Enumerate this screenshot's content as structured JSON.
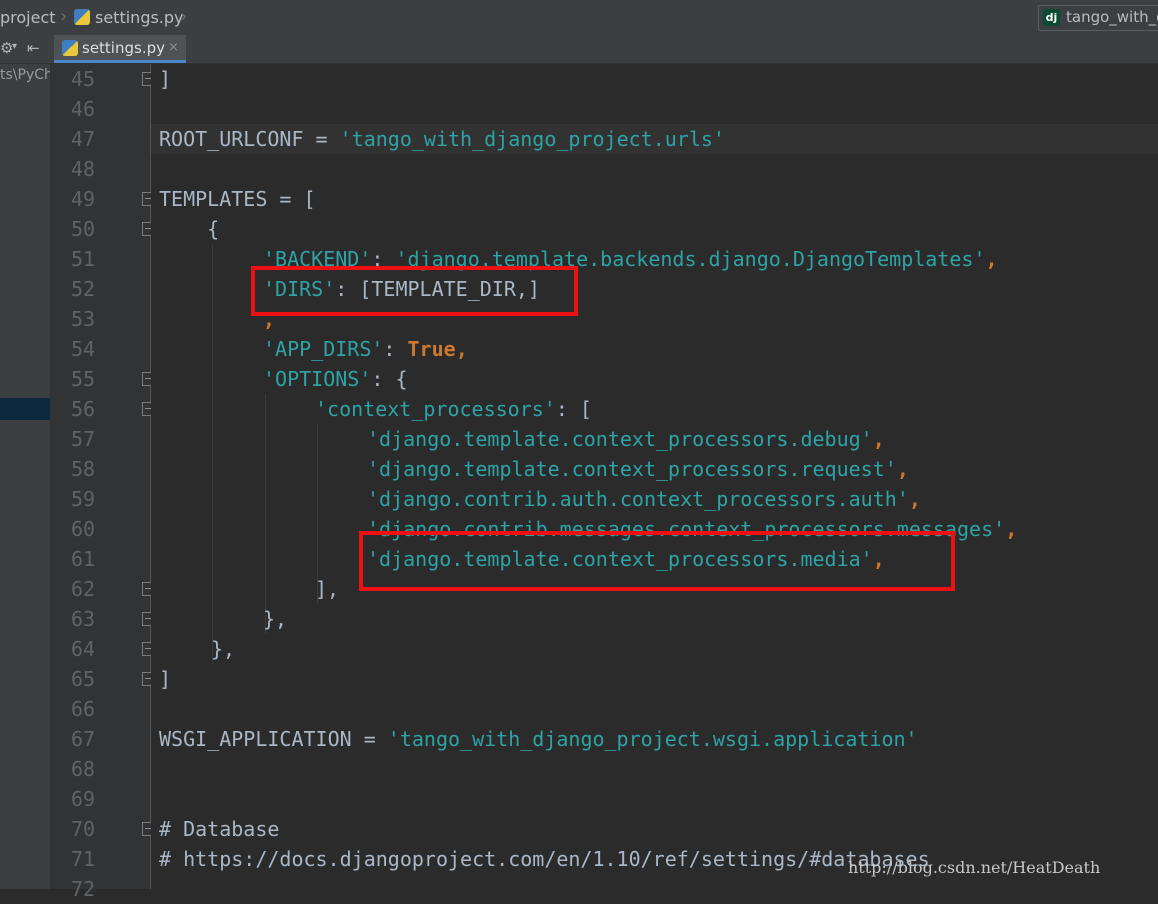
{
  "breadcrumb": {
    "project": "project",
    "file": "settings.py"
  },
  "run_config": {
    "icon": "dj",
    "label": "tango_with_django"
  },
  "tab": {
    "label": "settings.py",
    "close": "×"
  },
  "project_panel": {
    "path_fragment": "ts\\PyCh"
  },
  "line_numbers": [
    "45",
    "46",
    "47",
    "48",
    "49",
    "50",
    "51",
    "52",
    "53",
    "54",
    "55",
    "56",
    "57",
    "58",
    "59",
    "60",
    "61",
    "62",
    "63",
    "64",
    "65",
    "66",
    "67",
    "68",
    "69",
    "70",
    "71",
    "72"
  ],
  "code": {
    "l45": "]",
    "l47_name": "ROOT_URLCONF = ",
    "l47_value": "'tango_with_django_project.urls'",
    "l49": "TEMPLATES = [",
    "l50": "    {",
    "l51_key": "'BACKEND'",
    "l51_colon": ": ",
    "l51_value": "'django.template.backends.django.DjangoTemplates'",
    "l51_end": ",",
    "l52_key": "'DIRS'",
    "l52_rest": ": [TEMPLATE_DIR,]",
    "l53": ",",
    "l54_key": "'APP_DIRS'",
    "l54_colon": ": ",
    "l54_value": "True",
    "l54_end": ",",
    "l55_key": "'OPTIONS'",
    "l55_rest": ": {",
    "l56_key": "'context_processors'",
    "l56_rest": ": [",
    "l57": "'django.template.context_processors.debug'",
    "l58": "'django.template.context_processors.request'",
    "l59": "'django.contrib.auth.context_processors.auth'",
    "l60": "'django.contrib.messages.context_processors.messages'",
    "l61": "'django.template.context_processors.media'",
    "comma": ",",
    "l62": "],",
    "l63": "},",
    "l64": "},",
    "l65": "]",
    "l67_name": "WSGI_APPLICATION = ",
    "l67_value": "'tango_with_django_project.wsgi.application'",
    "l70": "# Database",
    "l71": "# https://docs.djangoproject.com/en/1.10/ref/settings/#databases"
  },
  "watermark": "http://blog.csdn.net/HeatDeath",
  "colors": {
    "string": "#2ea3a6",
    "keyword": "#cc7832",
    "plain": "#a9b7c6",
    "highlight_box": "#ee1111"
  }
}
